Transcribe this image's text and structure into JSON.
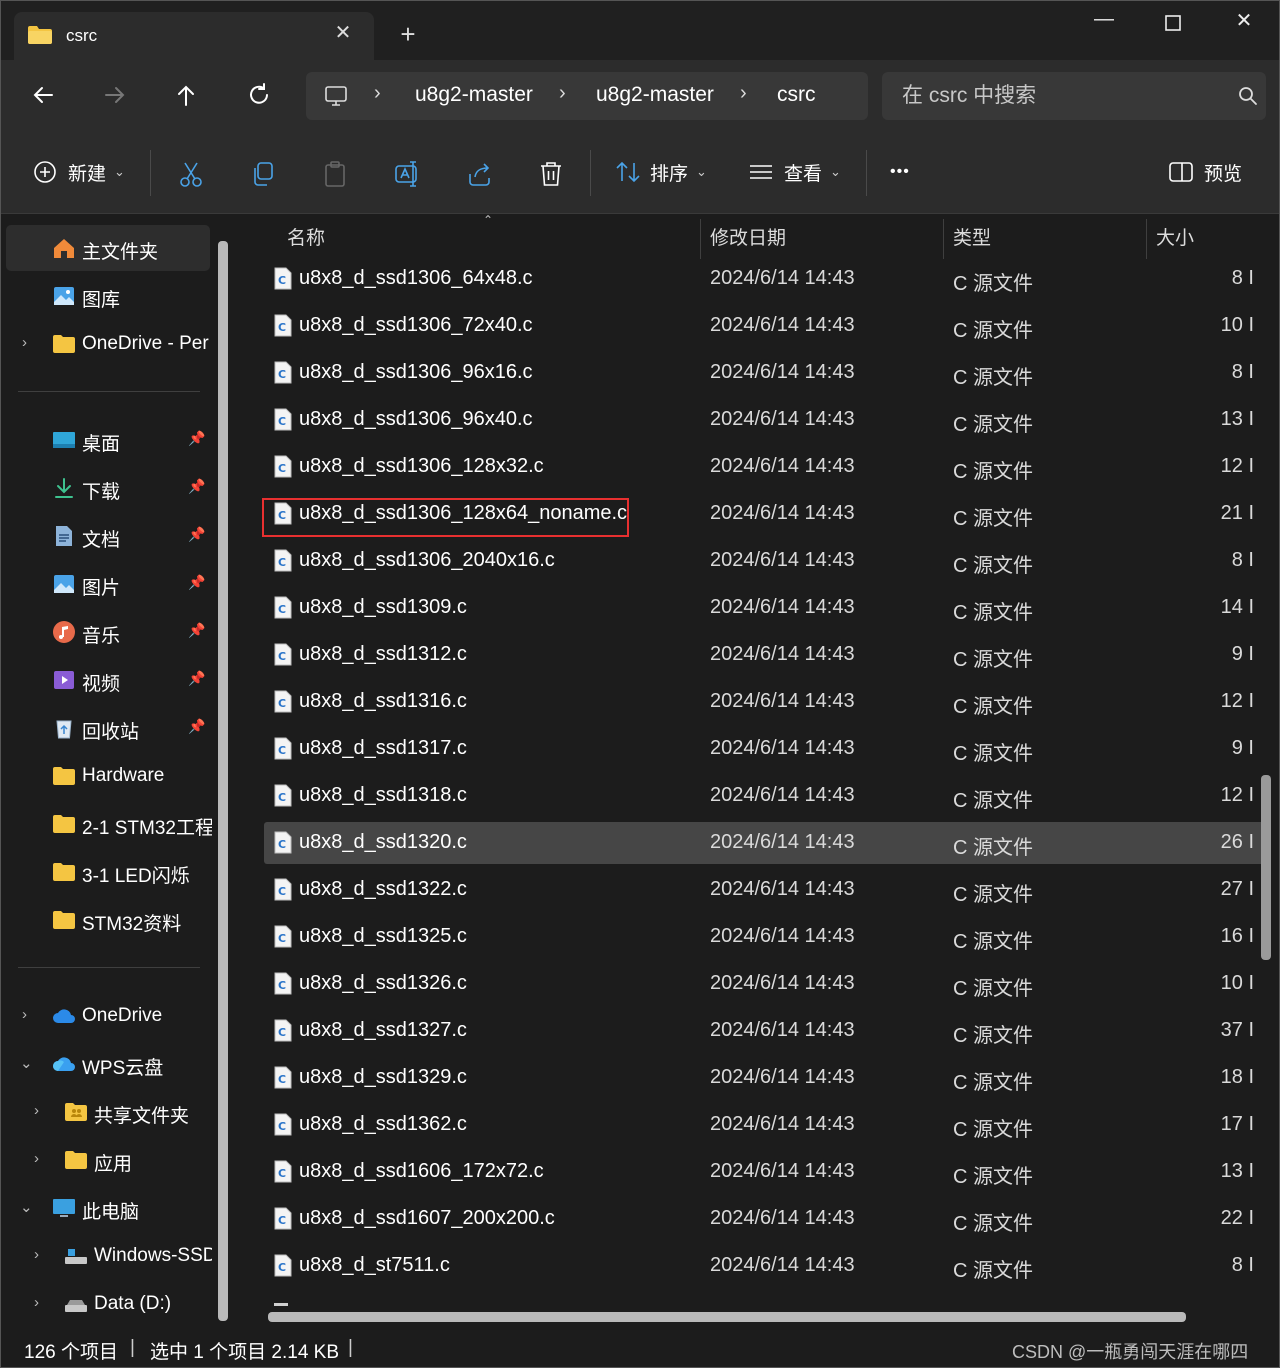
{
  "window": {
    "tab_title": "csrc",
    "minimize_glyph": "—",
    "maximize_glyph": "☐",
    "close_glyph": "✕"
  },
  "navigation": {
    "breadcrumbs": [
      "u8g2-master",
      "u8g2-master",
      "csrc"
    ],
    "search_placeholder": "在 csrc 中搜索"
  },
  "toolbar": {
    "new_label": "新建",
    "sort_label": "排序",
    "view_label": "查看",
    "more_label": "•••",
    "preview_label": "预览"
  },
  "sidebar": {
    "quick": [
      {
        "label": "主文件夹",
        "icon": "home-icon",
        "selected": true
      },
      {
        "label": "图库",
        "icon": "gallery-icon"
      },
      {
        "label": "OneDrive - Per",
        "icon": "folder-icon",
        "chevron": true
      }
    ],
    "pinned": [
      {
        "label": "桌面",
        "icon": "desktop-icon"
      },
      {
        "label": "下载",
        "icon": "download-icon"
      },
      {
        "label": "文档",
        "icon": "document-icon"
      },
      {
        "label": "图片",
        "icon": "pictures-icon"
      },
      {
        "label": "音乐",
        "icon": "music-icon"
      },
      {
        "label": "视频",
        "icon": "video-icon"
      },
      {
        "label": "回收站",
        "icon": "recycle-bin-icon"
      }
    ],
    "folders": [
      {
        "label": "Hardware",
        "icon": "folder-icon"
      },
      {
        "label": "2-1 STM32工程",
        "icon": "folder-icon"
      },
      {
        "label": "3-1 LED闪烁",
        "icon": "folder-icon"
      },
      {
        "label": "STM32资料",
        "icon": "folder-icon"
      }
    ],
    "tree": [
      {
        "label": "OneDrive",
        "icon": "cloud-icon",
        "chevron": "right",
        "level": 0
      },
      {
        "label": "WPS云盘",
        "icon": "wps-cloud-icon",
        "chevron": "down",
        "level": 0
      },
      {
        "label": "共享文件夹",
        "icon": "shared-folder-icon",
        "chevron": "right",
        "level": 1
      },
      {
        "label": "应用",
        "icon": "folder-icon",
        "chevron": "right",
        "level": 1
      },
      {
        "label": "此电脑",
        "icon": "computer-icon",
        "chevron": "down",
        "level": 0
      },
      {
        "label": "Windows-SSD",
        "icon": "drive-icon",
        "chevron": "right",
        "level": 1
      },
      {
        "label": "Data (D:)",
        "icon": "drive-icon",
        "chevron": "right",
        "level": 1
      }
    ]
  },
  "columns": {
    "name": "名称",
    "date": "修改日期",
    "type": "类型",
    "size": "大小"
  },
  "files": [
    {
      "name": "u8x8_d_ssd1306_64x48.c",
      "date": "2024/6/14 14:43",
      "type": "C 源文件",
      "size": "8 I"
    },
    {
      "name": "u8x8_d_ssd1306_72x40.c",
      "date": "2024/6/14 14:43",
      "type": "C 源文件",
      "size": "10 I"
    },
    {
      "name": "u8x8_d_ssd1306_96x16.c",
      "date": "2024/6/14 14:43",
      "type": "C 源文件",
      "size": "8 I"
    },
    {
      "name": "u8x8_d_ssd1306_96x40.c",
      "date": "2024/6/14 14:43",
      "type": "C 源文件",
      "size": "13 I"
    },
    {
      "name": "u8x8_d_ssd1306_128x32.c",
      "date": "2024/6/14 14:43",
      "type": "C 源文件",
      "size": "12 I"
    },
    {
      "name": "u8x8_d_ssd1306_128x64_noname.c",
      "date": "2024/6/14 14:43",
      "type": "C 源文件",
      "size": "21 I",
      "highlighted": true
    },
    {
      "name": "u8x8_d_ssd1306_2040x16.c",
      "date": "2024/6/14 14:43",
      "type": "C 源文件",
      "size": "8 I"
    },
    {
      "name": "u8x8_d_ssd1309.c",
      "date": "2024/6/14 14:43",
      "type": "C 源文件",
      "size": "14 I"
    },
    {
      "name": "u8x8_d_ssd1312.c",
      "date": "2024/6/14 14:43",
      "type": "C 源文件",
      "size": "9 I"
    },
    {
      "name": "u8x8_d_ssd1316.c",
      "date": "2024/6/14 14:43",
      "type": "C 源文件",
      "size": "12 I"
    },
    {
      "name": "u8x8_d_ssd1317.c",
      "date": "2024/6/14 14:43",
      "type": "C 源文件",
      "size": "9 I"
    },
    {
      "name": "u8x8_d_ssd1318.c",
      "date": "2024/6/14 14:43",
      "type": "C 源文件",
      "size": "12 I"
    },
    {
      "name": "u8x8_d_ssd1320.c",
      "date": "2024/6/14 14:43",
      "type": "C 源文件",
      "size": "26 I",
      "selected": true
    },
    {
      "name": "u8x8_d_ssd1322.c",
      "date": "2024/6/14 14:43",
      "type": "C 源文件",
      "size": "27 I"
    },
    {
      "name": "u8x8_d_ssd1325.c",
      "date": "2024/6/14 14:43",
      "type": "C 源文件",
      "size": "16 I"
    },
    {
      "name": "u8x8_d_ssd1326.c",
      "date": "2024/6/14 14:43",
      "type": "C 源文件",
      "size": "10 I"
    },
    {
      "name": "u8x8_d_ssd1327.c",
      "date": "2024/6/14 14:43",
      "type": "C 源文件",
      "size": "37 I"
    },
    {
      "name": "u8x8_d_ssd1329.c",
      "date": "2024/6/14 14:43",
      "type": "C 源文件",
      "size": "18 I"
    },
    {
      "name": "u8x8_d_ssd1362.c",
      "date": "2024/6/14 14:43",
      "type": "C 源文件",
      "size": "17 I"
    },
    {
      "name": "u8x8_d_ssd1606_172x72.c",
      "date": "2024/6/14 14:43",
      "type": "C 源文件",
      "size": "13 I"
    },
    {
      "name": "u8x8_d_ssd1607_200x200.c",
      "date": "2024/6/14 14:43",
      "type": "C 源文件",
      "size": "22 I"
    },
    {
      "name": "u8x8_d_st7511.c",
      "date": "2024/6/14 14:43",
      "type": "C 源文件",
      "size": "8 I"
    }
  ],
  "status": {
    "item_count": "126 个项目",
    "selection": "选中 1 个项目  2.14 KB",
    "watermark": "CSDN @一瓶勇闯天涯在哪四"
  },
  "colors": {
    "background": "#1c1c1c",
    "chrome": "#2c2c2c",
    "selected_row": "#464646",
    "highlight_box": "#e83030",
    "folder_yellow": "#f4c542",
    "accent_blue": "#4aa3e8"
  }
}
